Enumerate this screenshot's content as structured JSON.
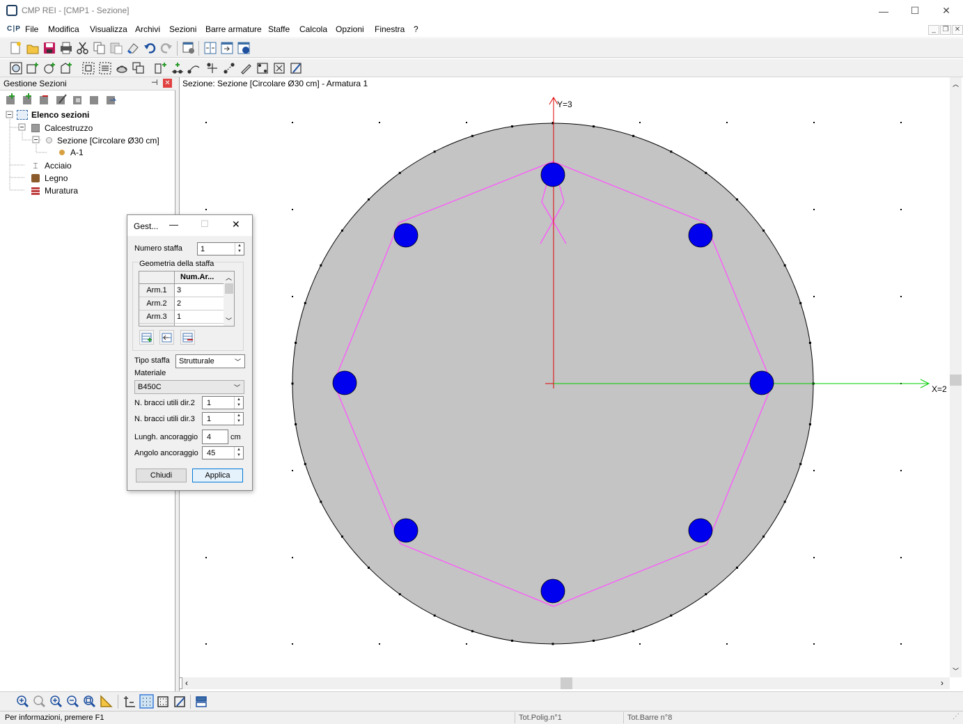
{
  "window": {
    "title": "CMP REI - [CMP1 - Sezione]",
    "minimize": "—",
    "maximize": "☐",
    "close": "✕"
  },
  "menu": [
    "File",
    "Modifica",
    "Visualizza",
    "Archivi",
    "Sezioni",
    "Barre armature",
    "Staffe",
    "Calcola",
    "Opzioni",
    "Finestra",
    "?"
  ],
  "menu_logo": "C∣P",
  "left_panel": {
    "title": "Gestione Sezioni",
    "tree": {
      "root": "Elenco sezioni",
      "calcestruzzo": "Calcestruzzo",
      "sezione": "Sezione [Circolare Ø30 cm]",
      "armatura": "A-1",
      "acciaio": "Acciaio",
      "legno": "Legno",
      "muratura": "Muratura"
    }
  },
  "canvas": {
    "header": "Sezione: Sezione [Circolare Ø30 cm] - Armatura 1",
    "y_axis_label": "Y=3",
    "x_axis_label": "X=2"
  },
  "dialog": {
    "title": "Gest...",
    "numero_staffa_label": "Numero staffa",
    "numero_staffa_value": "1",
    "geometria_label": "Geometria della staffa",
    "grid_header": "Num.Ar...",
    "grid_rows": [
      {
        "label": "Arm.1",
        "value": "3"
      },
      {
        "label": "Arm.2",
        "value": "2"
      },
      {
        "label": "Arm.3",
        "value": "1"
      }
    ],
    "tipo_staffa_label": "Tipo staffa",
    "tipo_staffa_value": "Strutturale",
    "materiale_label": "Materiale",
    "materiale_value": "B450C",
    "bracci2_label": "N. bracci utili dir.2",
    "bracci2_value": "1",
    "bracci3_label": "N. bracci utili dir.3",
    "bracci3_value": "1",
    "lungh_label": "Lungh. ancoraggio",
    "lungh_value": "4",
    "lungh_unit": "cm",
    "angolo_label": "Angolo ancoraggio",
    "angolo_value": "45",
    "chiudi": "Chiudi",
    "applica": "Applica"
  },
  "status": {
    "info": "Per informazioni, premere F1",
    "poligoni": "Tot.Polig.n°1",
    "barre": "Tot.Barre n°8"
  },
  "colors": {
    "section_fill": "#c4c4c4",
    "rebar": "#0000ee",
    "stirrup": "#ff55ff",
    "y_axis": "#e00000",
    "x_axis": "#00cc00"
  },
  "section": {
    "shape": "circle",
    "diameter_cm": 30,
    "bar_count": 8,
    "stirrup_vertices": 8
  }
}
